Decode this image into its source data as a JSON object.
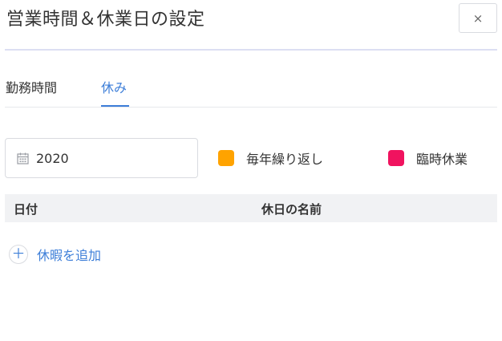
{
  "dialog": {
    "title": "営業時間＆休業日の設定",
    "close_icon": "×"
  },
  "tabs": [
    {
      "label": "勤務時間",
      "active": false
    },
    {
      "label": "休み",
      "active": true
    }
  ],
  "year_picker": {
    "icon": "calendar-icon",
    "value": "2020"
  },
  "legend": [
    {
      "label": "毎年繰り返し",
      "color": "#ffa300"
    },
    {
      "label": "臨時休業",
      "color": "#f0135f"
    }
  ],
  "table": {
    "columns": [
      "日付",
      "休日の名前"
    ],
    "rows": []
  },
  "add_holiday": {
    "icon": "＋",
    "label": "休暇を追加"
  },
  "colors": {
    "accent": "#3d7ed8",
    "header_bg": "#f1f2f4",
    "border": "#d9dbe0"
  }
}
